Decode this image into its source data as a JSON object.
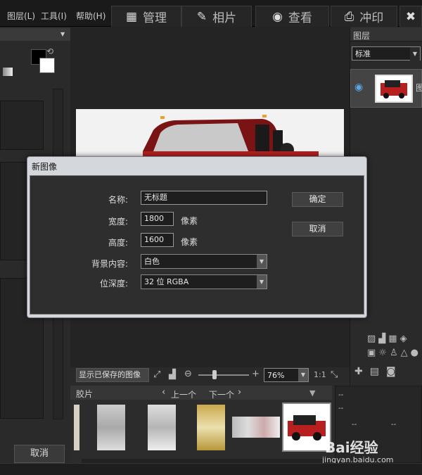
{
  "menu": {
    "layers": "图层(L)",
    "tools": "工具(I)",
    "help": "帮助(H)"
  },
  "tabs": [
    {
      "label": "管理"
    },
    {
      "label": "相片"
    },
    {
      "label": "查看"
    },
    {
      "label": "冲印"
    }
  ],
  "right_panel": {
    "title": "图层",
    "blend_mode": "标准",
    "layer_label": "图"
  },
  "dialog": {
    "title": "新图像",
    "name_label": "名称:",
    "name_value": "无标题",
    "width_label": "宽度:",
    "width_value": "1800",
    "width_unit": "像素",
    "height_label": "高度:",
    "height_value": "1600",
    "height_unit": "像素",
    "background_label": "背景内容:",
    "background_value": "白色",
    "bitdepth_label": "位深度:",
    "bitdepth_value": "32 位 RGBA",
    "ok_label": "确定",
    "cancel_label": "取消"
  },
  "canvas_toolbar": {
    "show_saved": "显示已保存的图像",
    "zoom": "76%",
    "ratio": "1:1"
  },
  "filmstrip": {
    "title": "胶片",
    "prev": "上一个",
    "next": "下一个"
  },
  "left_panel": {
    "cancel_label": "取消"
  },
  "info_panel": {
    "dash1": "--",
    "dash2": "--",
    "dash3": "--",
    "dash4": "--",
    "dash5": "--"
  },
  "watermark": {
    "brand": "Bai经验",
    "url": "jingyan.baidu.com"
  }
}
